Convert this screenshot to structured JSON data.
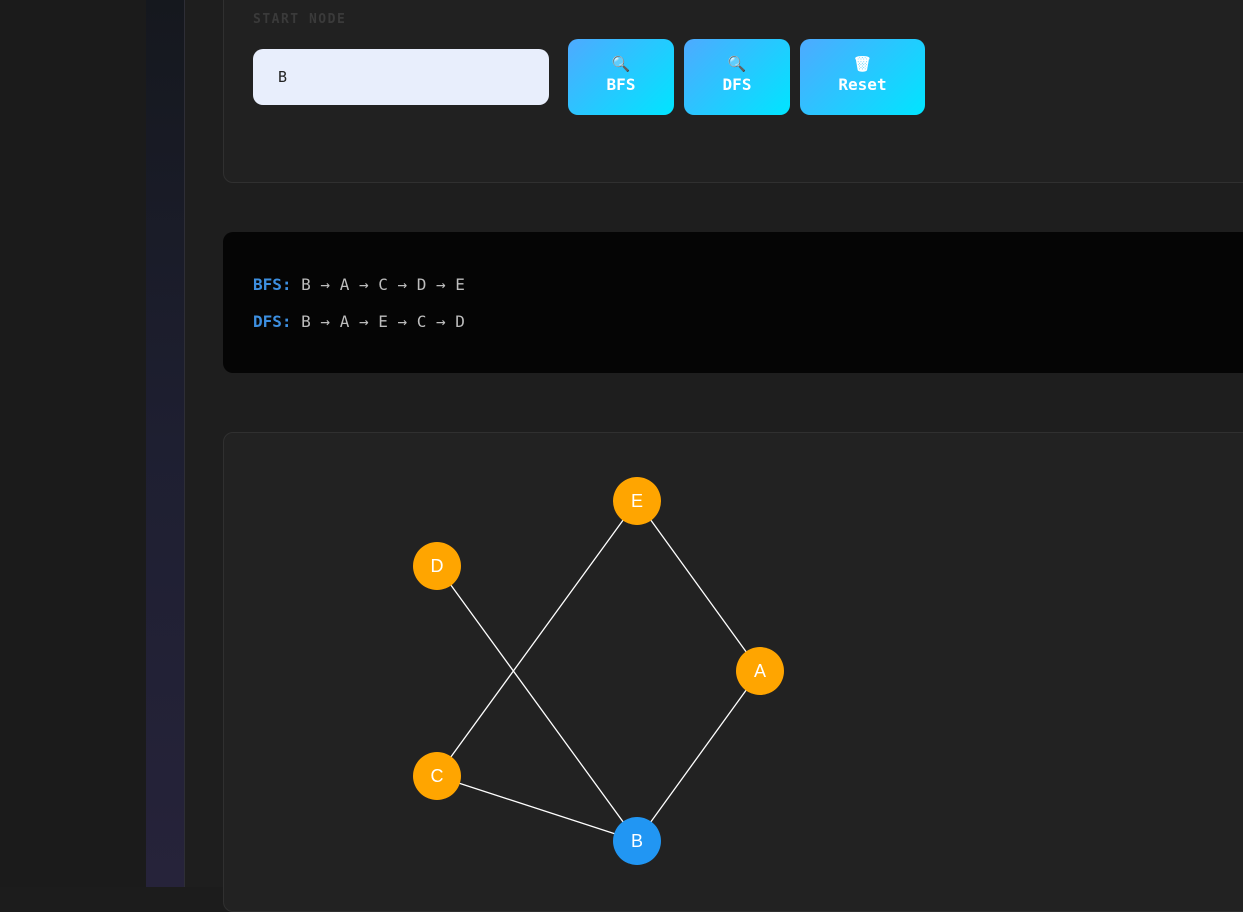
{
  "controls": {
    "start_label": "START NODE",
    "start_value": "B",
    "buttons": {
      "bfs": {
        "icon": "search-icon",
        "glyph": "🔍",
        "label": "BFS"
      },
      "dfs": {
        "icon": "search-icon",
        "glyph": "🔍",
        "label": "DFS"
      },
      "reset": {
        "icon": "trash-icon",
        "glyph": "🗑",
        "label": "Reset"
      }
    }
  },
  "output": {
    "bfs_key": "BFS:",
    "bfs_path": " B → A → C → D → E",
    "dfs_key": "DFS:",
    "dfs_path": " B → A → E → C → D"
  },
  "graph": {
    "nodes": [
      {
        "id": "A",
        "label": "A",
        "color": "#FFA500"
      },
      {
        "id": "B",
        "label": "B",
        "color": "#2196F3"
      },
      {
        "id": "C",
        "label": "C",
        "color": "#FFA500"
      },
      {
        "id": "D",
        "label": "D",
        "color": "#FFA500"
      },
      {
        "id": "E",
        "label": "E",
        "color": "#FFA500"
      }
    ],
    "edges": [
      [
        "B",
        "A"
      ],
      [
        "B",
        "C"
      ],
      [
        "B",
        "D"
      ],
      [
        "A",
        "E"
      ],
      [
        "E",
        "C"
      ]
    ],
    "edge_color": "#ffffff"
  }
}
